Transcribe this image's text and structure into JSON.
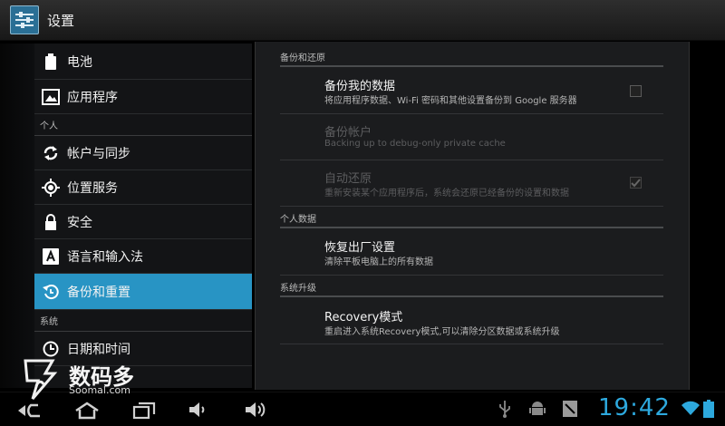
{
  "header": {
    "title": "设置"
  },
  "sidebar": {
    "items_top": [
      {
        "label": "电池",
        "icon": "battery-icon"
      },
      {
        "label": "应用程序",
        "icon": "apps-icon"
      }
    ],
    "section_personal": "个人",
    "items_personal": [
      {
        "label": "帐户与同步",
        "icon": "sync-icon"
      },
      {
        "label": "位置服务",
        "icon": "location-icon"
      },
      {
        "label": "安全",
        "icon": "lock-icon"
      },
      {
        "label": "语言和输入法",
        "icon": "language-icon"
      },
      {
        "label": "备份和重置",
        "icon": "backup-icon",
        "active": true
      }
    ],
    "section_system": "系统",
    "items_system": [
      {
        "label": "日期和时间",
        "icon": "clock-icon"
      }
    ]
  },
  "main": {
    "section_backup": "备份和还原",
    "backup_my_data": {
      "title": "备份我的数据",
      "summary": "将应用程序数据、Wi-Fi 密码和其他设置备份到 Google 服务器",
      "checked": false
    },
    "backup_account": {
      "title": "备份帐户",
      "summary": "Backing up to debug-only private cache"
    },
    "auto_restore": {
      "title": "自动还原",
      "summary": "重新安装某个应用程序后，系统会还原已经备份的设置和数据",
      "checked": true
    },
    "section_personal_data": "个人数据",
    "factory_reset": {
      "title": "恢复出厂设置",
      "summary": "清除平板电脑上的所有数据"
    },
    "section_upgrade": "系统升级",
    "recovery": {
      "title": "Recovery模式",
      "summary": "重启进入系统Recovery模式,可以清除分区数据或系统升级"
    }
  },
  "statusbar": {
    "time": "19:42"
  },
  "watermark": {
    "name": "数码多",
    "site": "Soomal.com"
  },
  "colors": {
    "accent": "#2894c4",
    "clock": "#2da9de"
  }
}
